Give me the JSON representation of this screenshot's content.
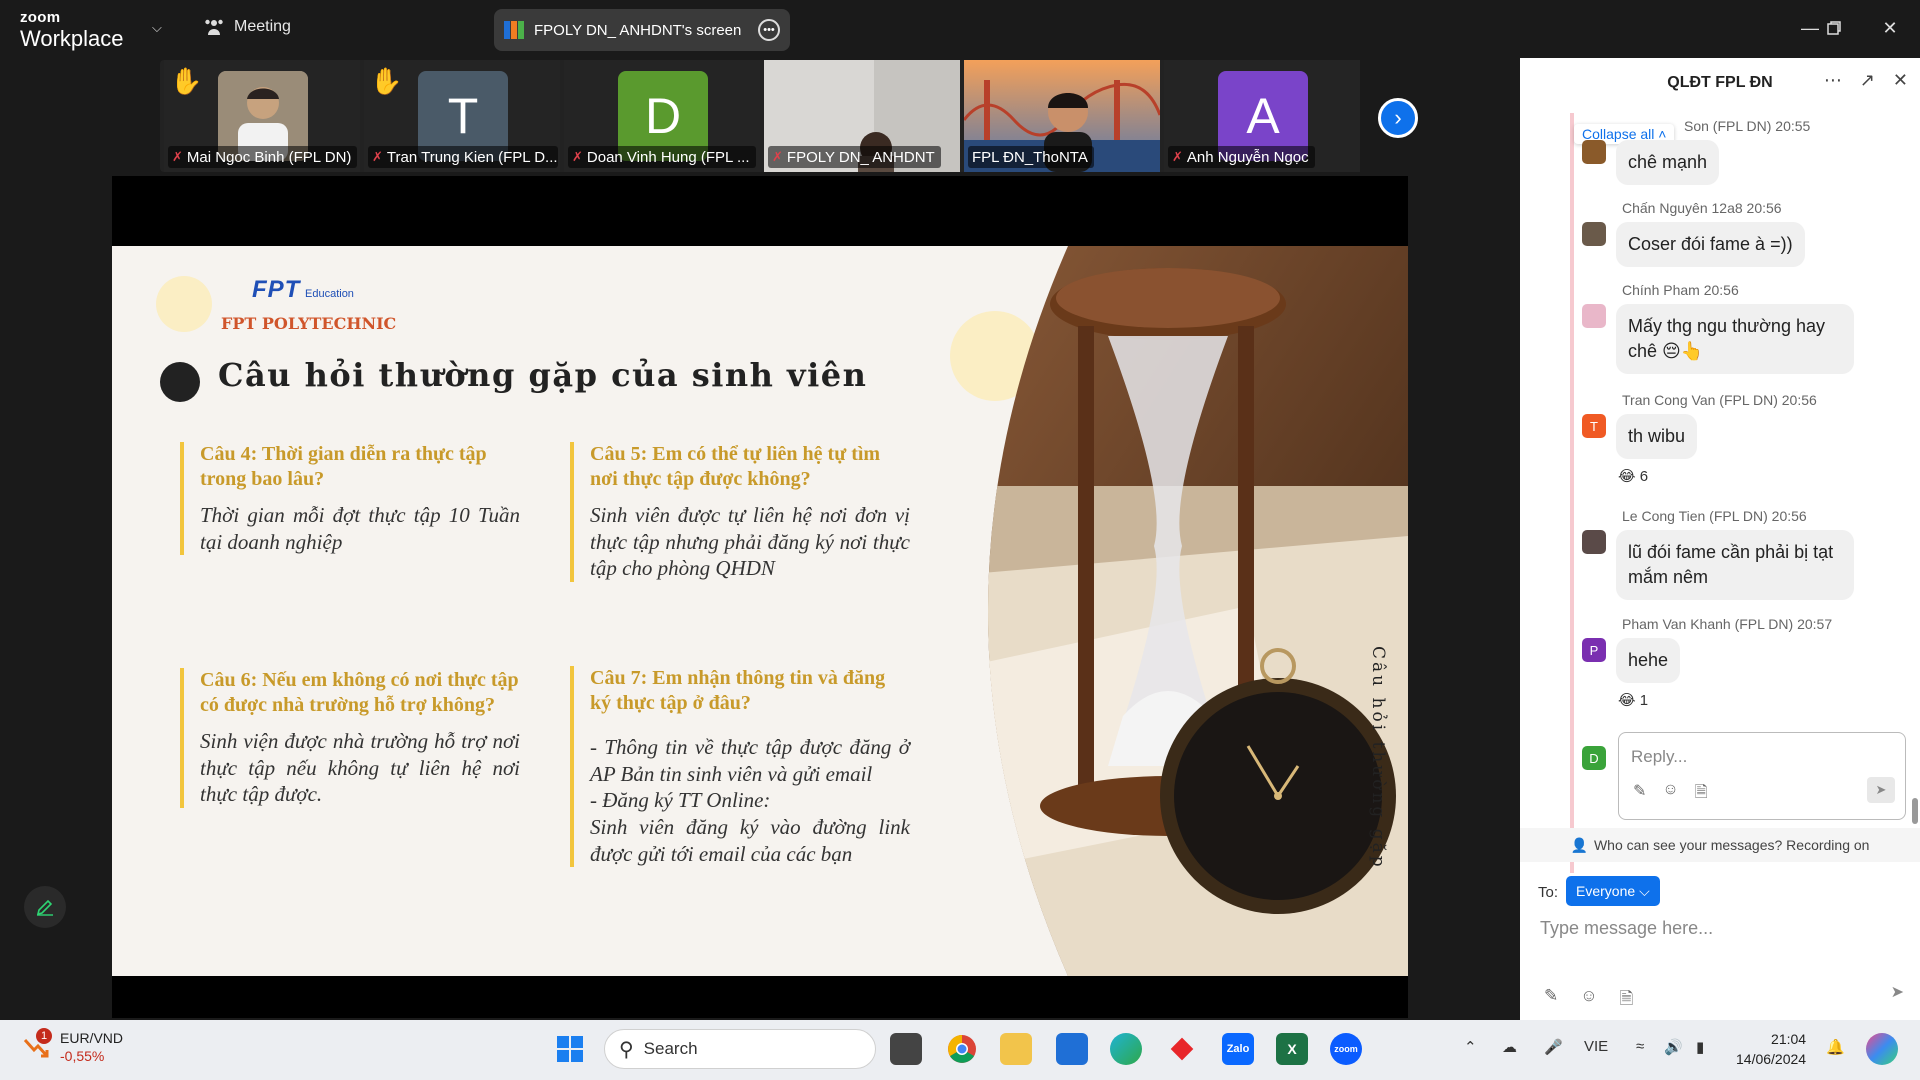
{
  "topbar": {
    "brand_small": "zoom",
    "brand_large": "Workplace",
    "meeting_label": "Meeting",
    "share_title": "FPOLY DN_ ANHDNT's screen"
  },
  "participants": [
    {
      "name": "Mai Ngoc Binh (FPL DN)",
      "initial": "",
      "color": "#7a6a5a",
      "hand": true,
      "muted": true
    },
    {
      "name": "Tran Trung Kien (FPL D...",
      "initial": "T",
      "color": "#4a5a68",
      "hand": true,
      "muted": true
    },
    {
      "name": "Doan Vinh Hung (FPL ...",
      "initial": "D",
      "color": "#5a9a2e",
      "hand": false,
      "muted": true
    },
    {
      "name": "FPOLY DN_ ANHDNT",
      "initial": "",
      "color": "#c8c8c8",
      "hand": false,
      "muted": true
    },
    {
      "name": "FPL ĐN_ThoNTA",
      "initial": "",
      "color": "#a0764e",
      "hand": false,
      "muted": false
    },
    {
      "name": "Anh Nguyễn Ngọc",
      "initial": "A",
      "color": "#7a44c9",
      "hand": false,
      "muted": true
    }
  ],
  "slide": {
    "brand_fpt": "FPT",
    "brand_edu": "Education",
    "brand_poly": "FPT POLYTECHNIC",
    "title": "Câu hỏi thường gặp của sinh viên",
    "side_text": "Câu hỏi thường gặp",
    "q4": {
      "h": "Câu 4:  Thời gian diễn ra thực tập trong bao lâu?",
      "a": "Thời gian mỗi đợt thực tập 10 Tuần tại doanh nghiệp"
    },
    "q5": {
      "h": "Câu 5:  Em có thể tự liên hệ tự tìm nơi thực tập được không?",
      "a": "Sinh viên được tự liên hệ nơi đơn vị thực tập nhưng phải đăng ký nơi thực tập cho phòng QHDN"
    },
    "q6": {
      "h": "Câu 6:  Nếu em không có nơi thực tập có được nhà trường hỗ trợ không?",
      "a": "Sinh viện được nhà trường hỗ trợ nơi thực tập nếu không tự liên hệ nơi thực tập được."
    },
    "q7": {
      "h": "Câu 7:  Em nhận thông tin và đăng ký thực tập ở đâu?",
      "a": "- Thông tin về thực tập được đăng ở AP Bản tin sinh viên và gửi email\n- Đăng ký TT Online:\nSinh viên đăng ký vào đường link được gửi tới email của các bạn"
    }
  },
  "chat": {
    "title": "QLĐT FPL ĐN",
    "collapse_all": "Collapse all",
    "messages": [
      {
        "who": "Son (FPL DN) 20:55",
        "text": "chê mạnh",
        "avatar": "",
        "avatar_color": "#8a5a2a",
        "reaction": ""
      },
      {
        "who": "Chấn Nguyên 12a8 20:56",
        "text": "Coser đói fame à =))",
        "avatar": "",
        "avatar_color": "#6a5a4a",
        "reaction": ""
      },
      {
        "who": "Chính Pham 20:56",
        "text": "Mấy thg ngu thường hay chê 😔👆",
        "avatar": "",
        "avatar_color": "#e9b7c9",
        "reaction": ""
      },
      {
        "who": "Tran Cong Van (FPL DN) 20:56",
        "text": "th wibu",
        "avatar": "T",
        "avatar_color": "#f05a24",
        "reaction": "😂 6"
      },
      {
        "who": "Le Cong Tien (FPL DN) 20:56",
        "text": "lũ đói fame cần phải bị tạt mắm nêm",
        "avatar": "",
        "avatar_color": "#5a4a48",
        "reaction": ""
      },
      {
        "who": "Pham Van Khanh (FPL DN) 20:57",
        "text": "hehe",
        "avatar": "P",
        "avatar_color": "#7a2fb0",
        "reaction": "😂 1"
      }
    ],
    "reply_avatar": "D",
    "reply_placeholder": "Reply...",
    "visibility_notice": "Who can see your messages? Recording on",
    "to_label": "To:",
    "recipient": "Everyone",
    "message_placeholder": "Type message here..."
  },
  "taskbar": {
    "fx_badge": "1",
    "fx_pair": "EUR/VND",
    "fx_change": "-0,55%",
    "search_label": "Search",
    "lang": "VIE",
    "time": "21:04",
    "date": "14/06/2024"
  }
}
